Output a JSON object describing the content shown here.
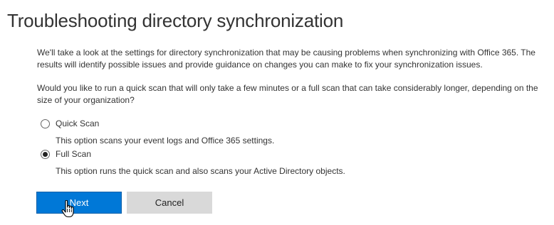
{
  "page": {
    "title": "Troubleshooting directory synchronization",
    "intro": "We'll take a look at the settings for directory synchronization that may be causing problems when synchronizing with Office 365. The results will identify possible issues and provide guidance on changes you can make to fix your synchronization issues.",
    "question": "Would you like to run a quick scan that will only take a few minutes or a full scan that can take considerably longer, depending on the size of your organization?"
  },
  "options": [
    {
      "label": "Quick Scan",
      "description": "This option scans your event logs and Office 365 settings.",
      "selected": false
    },
    {
      "label": "Full Scan",
      "description": "This option runs the quick scan and also scans your Active Directory objects.",
      "selected": true
    }
  ],
  "buttons": {
    "next_label": "Next",
    "cancel_label": "Cancel"
  },
  "colors": {
    "primary": "#0078d7",
    "secondary": "#d9d9d9"
  },
  "cursor": "hand-pointer-icon"
}
